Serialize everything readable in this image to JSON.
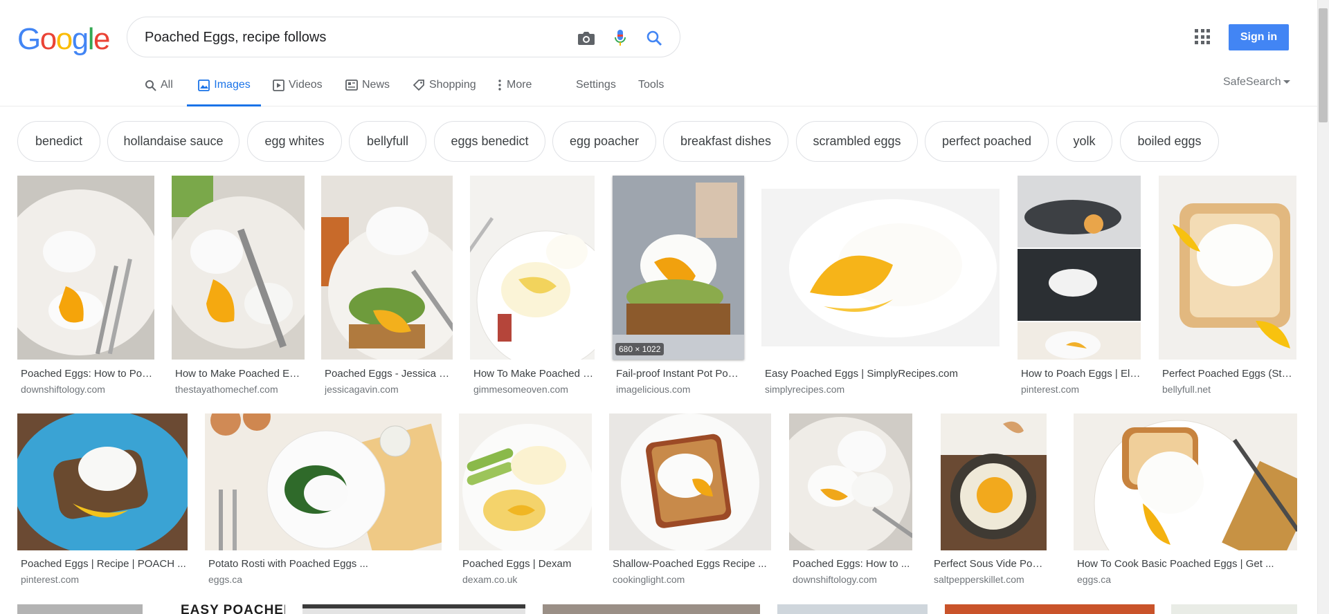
{
  "logo": {
    "letters": [
      "G",
      "o",
      "o",
      "g",
      "l",
      "e"
    ],
    "colors": [
      "#4285f4",
      "#ea4335",
      "#fbbc05",
      "#4285f4",
      "#34a853",
      "#ea4335"
    ]
  },
  "search": {
    "query": "Poached Eggs, recipe follows",
    "icons": [
      "camera-icon",
      "microphone-icon",
      "search-icon"
    ]
  },
  "header": {
    "sign_in": "Sign in",
    "apps_icon": "apps-grid-icon",
    "accent": "#4285f4"
  },
  "tabs": [
    {
      "label": "All",
      "icon": "search-icon"
    },
    {
      "label": "Images",
      "icon": "image-icon",
      "active": true
    },
    {
      "label": "Videos",
      "icon": "play-icon"
    },
    {
      "label": "News",
      "icon": "news-icon"
    },
    {
      "label": "Shopping",
      "icon": "tag-icon"
    },
    {
      "label": "More",
      "icon": "more-vertical-icon"
    },
    {
      "label": "Settings"
    },
    {
      "label": "Tools"
    }
  ],
  "safesearch": "SafeSearch",
  "chips": [
    "benedict",
    "hollandaise sauce",
    "egg whites",
    "bellyfull",
    "eggs benedict",
    "egg poacher",
    "breakfast dishes",
    "scrambled eggs",
    "perfect poached",
    "yolk",
    "boiled eggs"
  ],
  "results_row1": [
    {
      "title": "Poached Eggs: How to Poach Eggs | Downshiftology",
      "site": "downshiftology.com"
    },
    {
      "title": "How to Make Poached Eggs",
      "site": "thestayathomechef.com"
    },
    {
      "title": "Poached Eggs - Jessica Gavin",
      "site": "jessicagavin.com"
    },
    {
      "title": "How To Make Poached Eggs",
      "site": "gimmesomeoven.com"
    },
    {
      "title": "Fail-proof Instant Pot Poached Eggs",
      "site": "imagelicious.com",
      "dims": "680 × 1022"
    },
    {
      "title": "Easy Poached Eggs | SimplyRecipes.com",
      "site": "simplyrecipes.com"
    },
    {
      "title": "How to Poach Eggs | Eleven",
      "site": "pinterest.com"
    },
    {
      "title": "Perfect Poached Eggs (Step by Step)",
      "site": "bellyfull.net"
    }
  ],
  "results_row2": [
    {
      "title": "Poached Eggs | Recipe | POACH ...",
      "site": "pinterest.com"
    },
    {
      "title": "Potato Rosti with Poached Eggs ...",
      "site": "eggs.ca"
    },
    {
      "title": "Poached Eggs | Dexam",
      "site": "dexam.co.uk"
    },
    {
      "title": "Shallow-Poached Eggs Recipe ...",
      "site": "cookinglight.com"
    },
    {
      "title": "Poached Eggs: How to ...",
      "site": "downshiftology.com"
    },
    {
      "title": "Perfect Sous Vide Poached Eggs",
      "site": "saltpepperskillet.com"
    },
    {
      "title": "How To Cook Basic Poached Eggs | Get ...",
      "site": "eggs.ca"
    }
  ],
  "row3_partial_text": "EASY POACHED"
}
